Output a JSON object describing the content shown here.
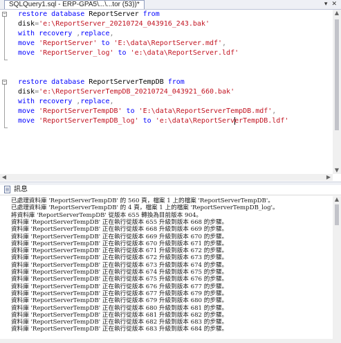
{
  "tab": {
    "title": "SQLQuery1.sql - ERP-GPA5\\...\\...tor (53))*",
    "dropdown_icon": "chevron-down-icon",
    "close_icon": "close-icon"
  },
  "editor": {
    "lines": [
      [
        {
          "t": "restore database ",
          "c": "kw"
        },
        {
          "t": "ReportServer ",
          "c": "pln"
        },
        {
          "t": "from",
          "c": "kw"
        }
      ],
      [
        {
          "t": "disk",
          "c": "pln"
        },
        {
          "t": "=",
          "c": "gr"
        },
        {
          "t": "'e:\\ReportServer_20210724_043916_243.bak'",
          "c": "str"
        }
      ],
      [
        {
          "t": "with recovery ",
          "c": "kw"
        },
        {
          "t": ",",
          "c": "gr"
        },
        {
          "t": "replace",
          "c": "kw"
        },
        {
          "t": ",",
          "c": "gr"
        }
      ],
      [
        {
          "t": "move ",
          "c": "kw"
        },
        {
          "t": "'ReportServer'",
          "c": "str"
        },
        {
          "t": " to ",
          "c": "kw"
        },
        {
          "t": "'E:\\data\\ReportServer.mdf'",
          "c": "str"
        },
        {
          "t": ",",
          "c": "gr"
        }
      ],
      [
        {
          "t": "move ",
          "c": "kw"
        },
        {
          "t": "'ReportServer_log'",
          "c": "str"
        },
        {
          "t": " to ",
          "c": "kw"
        },
        {
          "t": "'e:\\data\\ReportServer.ldf'",
          "c": "str"
        }
      ],
      [],
      [],
      [
        {
          "t": "restore database ",
          "c": "kw"
        },
        {
          "t": "ReportServerTempDB ",
          "c": "pln"
        },
        {
          "t": "from",
          "c": "kw"
        }
      ],
      [
        {
          "t": "disk",
          "c": "pln"
        },
        {
          "t": "=",
          "c": "gr"
        },
        {
          "t": "'e:\\ReportServerTempDB_20210724_043921_660.bak'",
          "c": "str"
        }
      ],
      [
        {
          "t": "with recovery ",
          "c": "kw"
        },
        {
          "t": ",",
          "c": "gr"
        },
        {
          "t": "replace",
          "c": "kw"
        },
        {
          "t": ",",
          "c": "gr"
        }
      ],
      [
        {
          "t": "move ",
          "c": "kw"
        },
        {
          "t": "'ReportServerTempDB'",
          "c": "str"
        },
        {
          "t": " to ",
          "c": "kw"
        },
        {
          "t": "'E:\\data\\ReportServerTempDB.mdf'",
          "c": "str"
        },
        {
          "t": ",",
          "c": "gr"
        }
      ],
      [
        {
          "t": "move ",
          "c": "kw"
        },
        {
          "t": "'ReportServerTempDB_log'",
          "c": "str"
        },
        {
          "t": " to ",
          "c": "kw"
        },
        {
          "t": "'e:\\data\\ReportServ",
          "c": "str"
        },
        {
          "t": "|caret|",
          "c": "caret"
        },
        {
          "t": "erTempDB.ldf'",
          "c": "str"
        }
      ]
    ]
  },
  "messages_tab": {
    "label": "訊息",
    "icon": "message-icon"
  },
  "messages": [
    "已處理資料庫 'ReportServerTempDB' 的 560 頁，檔案 1 上的檔案 'ReportServerTempDB'。",
    "已處理資料庫 'ReportServerTempDB' 的 4 頁，檔案 1 上的檔案 'ReportServerTempDB_log'。",
    "將資料庫 'ReportServerTempDB' 從版本 655 轉換為目前版本 904。",
    "資料庫 'ReportServerTempDB' 正在執行從版本 655 升級到版本 668 的步驟。",
    "資料庫 'ReportServerTempDB' 正在執行從版本 668 升級到版本 669 的步驟。",
    "資料庫 'ReportServerTempDB' 正在執行從版本 669 升級到版本 670 的步驟。",
    "資料庫 'ReportServerTempDB' 正在執行從版本 670 升級到版本 671 的步驟。",
    "資料庫 'ReportServerTempDB' 正在執行從版本 671 升級到版本 672 的步驟。",
    "資料庫 'ReportServerTempDB' 正在執行從版本 672 升級到版本 673 的步驟。",
    "資料庫 'ReportServerTempDB' 正在執行從版本 673 升級到版本 674 的步驟。",
    "資料庫 'ReportServerTempDB' 正在執行從版本 674 升級到版本 675 的步驟。",
    "資料庫 'ReportServerTempDB' 正在執行從版本 675 升級到版本 676 的步驟。",
    "資料庫 'ReportServerTempDB' 正在執行從版本 676 升級到版本 677 的步驟。",
    "資料庫 'ReportServerTempDB' 正在執行從版本 677 升級到版本 679 的步驟。",
    "資料庫 'ReportServerTempDB' 正在執行從版本 679 升級到版本 680 的步驟。",
    "資料庫 'ReportServerTempDB' 正在執行從版本 680 升級到版本 681 的步驟。",
    "資料庫 'ReportServerTempDB' 正在執行從版本 681 升級到版本 682 的步驟。",
    "資料庫 'ReportServerTempDB' 正在執行從版本 682 升級到版本 683 的步驟。",
    "資料庫 'ReportServerTempDB' 正在執行從版本 683 升級到版本 684 的步驟。"
  ],
  "colors": {
    "keyword": "#0000ff",
    "string": "#c1121f",
    "operator": "#808080"
  }
}
